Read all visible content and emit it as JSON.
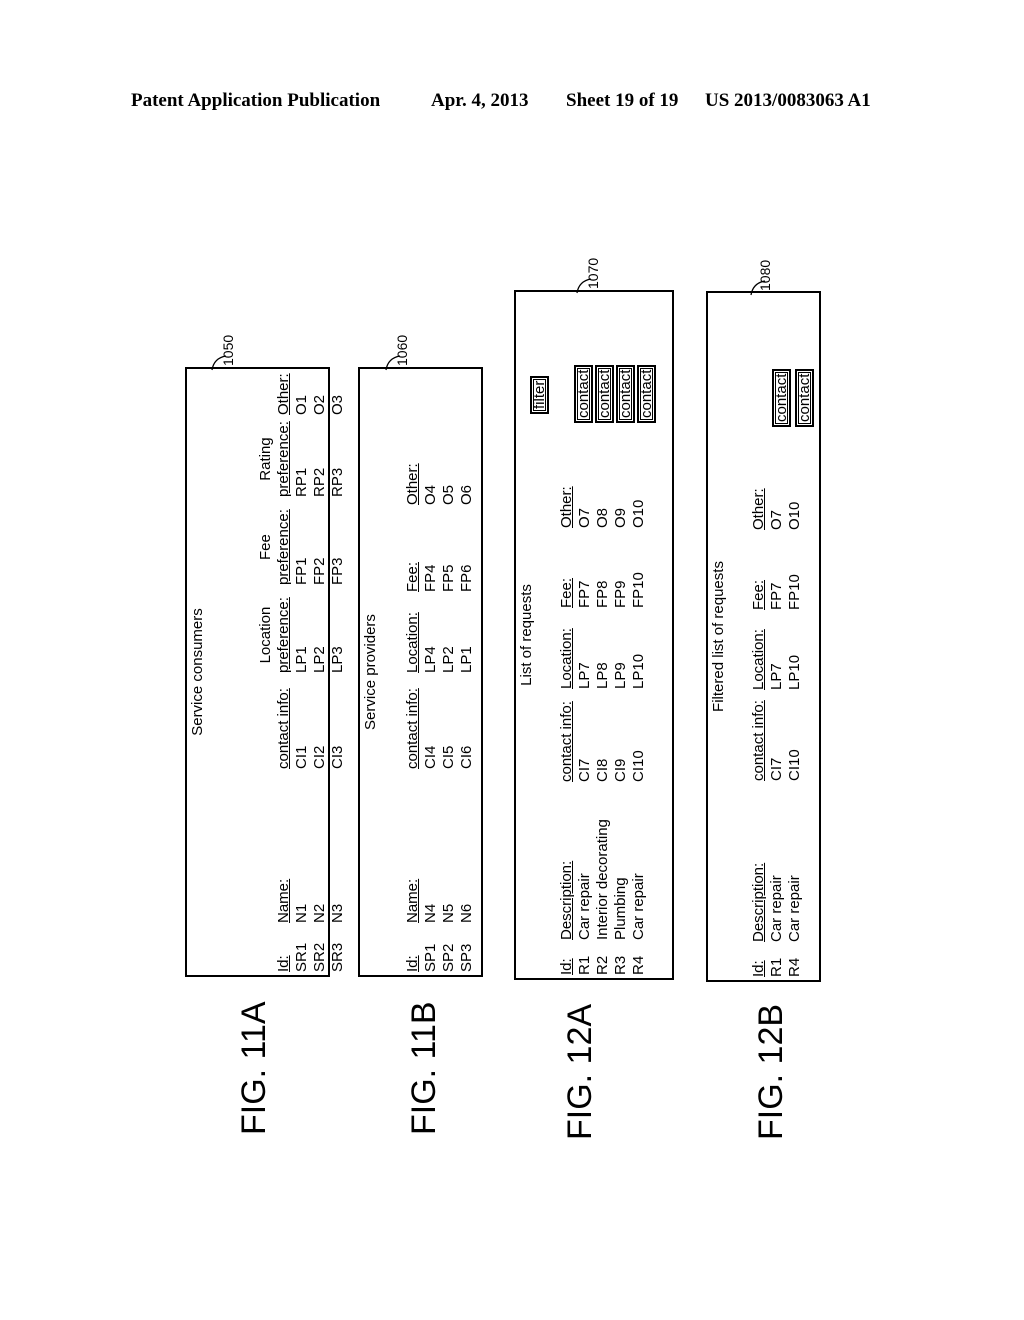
{
  "header": {
    "publication": "Patent Application Publication",
    "date": "Apr. 4, 2013",
    "sheet": "Sheet 19 of 19",
    "number": "US 2013/0083063 A1"
  },
  "fig11a": {
    "label": "FIG. 11A",
    "ref": "1050",
    "title": "Service consumers",
    "columns": [
      {
        "top": "",
        "head": "Id:",
        "values": [
          "SR1",
          "SR2",
          "SR3"
        ]
      },
      {
        "top": "",
        "head": "Name:",
        "values": [
          "N1",
          "N2",
          "N3"
        ]
      },
      {
        "top": "",
        "head": "contact info:",
        "values": [
          "CI1",
          "CI2",
          "CI3"
        ]
      },
      {
        "top": "Location",
        "head": "preference:",
        "values": [
          "LP1",
          "LP2",
          "LP3"
        ]
      },
      {
        "top": "Fee",
        "head": "preference:",
        "values": [
          "FP1",
          "FP2",
          "FP3"
        ]
      },
      {
        "top": "Rating",
        "head": "preference:",
        "values": [
          "RP1",
          "RP2",
          "RP3"
        ]
      },
      {
        "top": "",
        "head": "Other:",
        "values": [
          "O1",
          "O2",
          "O3"
        ]
      }
    ]
  },
  "fig11b": {
    "label": "FIG. 11B",
    "ref": "1060",
    "title": "Service providers",
    "columns": [
      {
        "head": "Id:",
        "values": [
          "SP1",
          "SP2",
          "SP3"
        ]
      },
      {
        "head": "Name:",
        "values": [
          "N4",
          "N5",
          "N6"
        ]
      },
      {
        "head": "contact info:",
        "values": [
          "CI4",
          "CI5",
          "CI6"
        ]
      },
      {
        "head": "Location:",
        "values": [
          "LP4",
          "LP2",
          "LP1"
        ]
      },
      {
        "head": "Fee:",
        "values": [
          "FP4",
          "FP5",
          "FP6"
        ]
      },
      {
        "head": "Other:",
        "values": [
          "O4",
          "O5",
          "O6"
        ]
      }
    ]
  },
  "fig12a": {
    "label": "FIG. 12A",
    "ref": "1070",
    "title": "List of requests",
    "filter_button": "filter",
    "contact_button": "contact",
    "columns": [
      {
        "head": "Id:",
        "values": [
          "R1",
          "R2",
          "R3",
          "R4"
        ]
      },
      {
        "head": "Description:",
        "values": [
          "Car repair",
          "Interior decorating",
          "Plumbing",
          "Car repair"
        ]
      },
      {
        "head": "contact info:",
        "values": [
          "CI7",
          "CI8",
          "CI9",
          "CI10"
        ]
      },
      {
        "head": "Location:",
        "values": [
          "LP7",
          "LP8",
          "LP9",
          "LP10"
        ]
      },
      {
        "head": "Fee:",
        "values": [
          "FP7",
          "FP8",
          "FP9",
          "FP10"
        ]
      },
      {
        "head": "Other:",
        "values": [
          "O7",
          "O8",
          "O9",
          "O10"
        ]
      }
    ]
  },
  "fig12b": {
    "label": "FIG. 12B",
    "ref": "1080",
    "title": "Filtered list of requests",
    "contact_button": "contact",
    "columns": [
      {
        "head": "Id:",
        "values": [
          "R1",
          "R4"
        ]
      },
      {
        "head": "Description:",
        "values": [
          "Car repair",
          "Car repair"
        ]
      },
      {
        "head": "contact info:",
        "values": [
          "CI7",
          "CI10"
        ]
      },
      {
        "head": "Location:",
        "values": [
          "LP7",
          "LP10"
        ]
      },
      {
        "head": "Fee:",
        "values": [
          "FP7",
          "FP10"
        ]
      },
      {
        "head": "Other:",
        "values": [
          "O7",
          "O10"
        ]
      }
    ]
  }
}
